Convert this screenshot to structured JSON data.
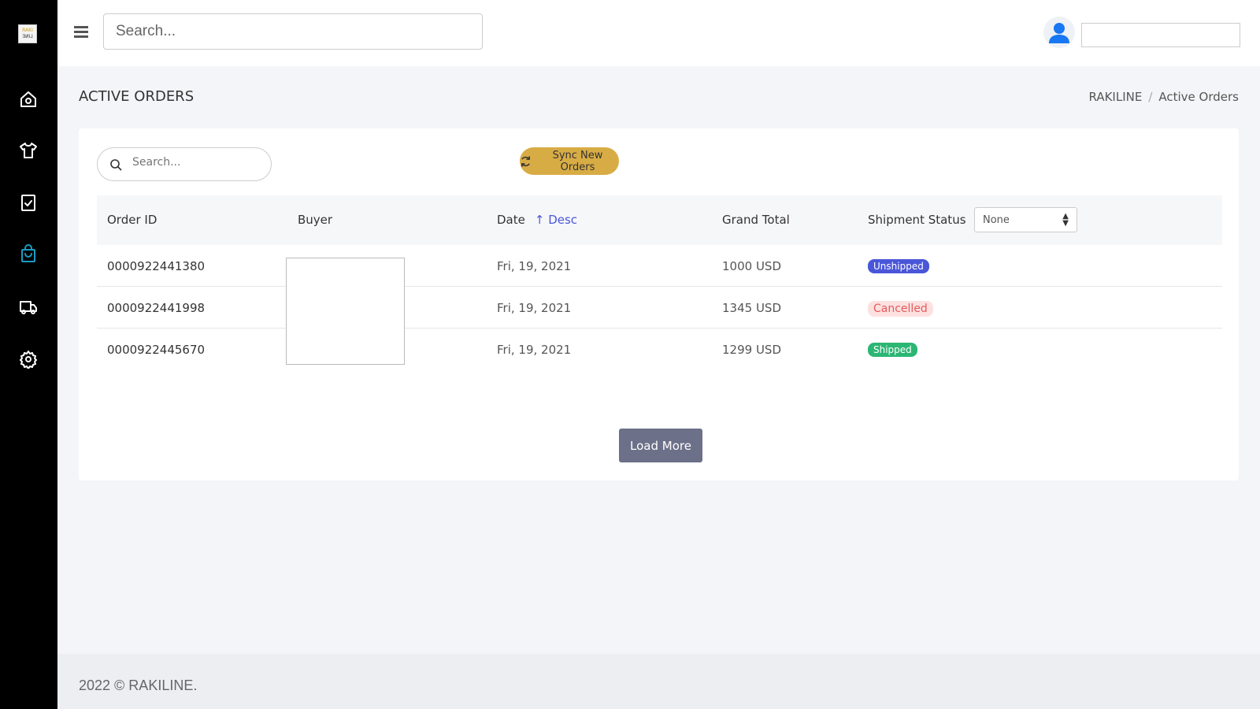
{
  "brand": {
    "logo_text_top": "RAKI",
    "logo_text_bottom": "LINE"
  },
  "sidebar": {
    "items": [
      {
        "icon": "home-icon"
      },
      {
        "icon": "tshirt-icon"
      },
      {
        "icon": "clipboard-check-icon"
      },
      {
        "icon": "shopping-bag-icon",
        "active": true
      },
      {
        "icon": "truck-icon"
      },
      {
        "icon": "gear-icon"
      }
    ]
  },
  "header": {
    "search_placeholder": "Search...",
    "user_input_value": ""
  },
  "page": {
    "title": "ACTIVE ORDERS",
    "breadcrumb": [
      "RAKILINE",
      "Active Orders"
    ]
  },
  "toolbar": {
    "search_placeholder": "Search...",
    "sync_label": "Sync New Orders"
  },
  "table": {
    "columns": {
      "order_id": "Order ID",
      "buyer": "Buyer",
      "date": "Date",
      "sort": "↑ Desc",
      "grand_total": "Grand Total",
      "shipment_status": "Shipment Status"
    },
    "filter_value": "None",
    "rows": [
      {
        "order_id": "0000922441380",
        "date": "Fri, 19, 2021",
        "total": "1000 USD",
        "status": "Unshipped"
      },
      {
        "order_id": "0000922441998",
        "date": "Fri, 19, 2021",
        "total": "1345 USD",
        "status": "Cancelled"
      },
      {
        "order_id": "0000922445670",
        "date": "Fri, 19, 2021",
        "total": "1299 USD",
        "status": "Shipped"
      }
    ]
  },
  "load_more_label": "Load More",
  "footer": {
    "text": "2022 © RAKILINE."
  },
  "colors": {
    "accent": "#d8ac45",
    "unshipped": "#4a56d8",
    "cancelled_bg": "#fde1e1",
    "cancelled_text": "#e55a5a",
    "shipped": "#2bb673",
    "active_nav": "#1a9bc2"
  }
}
